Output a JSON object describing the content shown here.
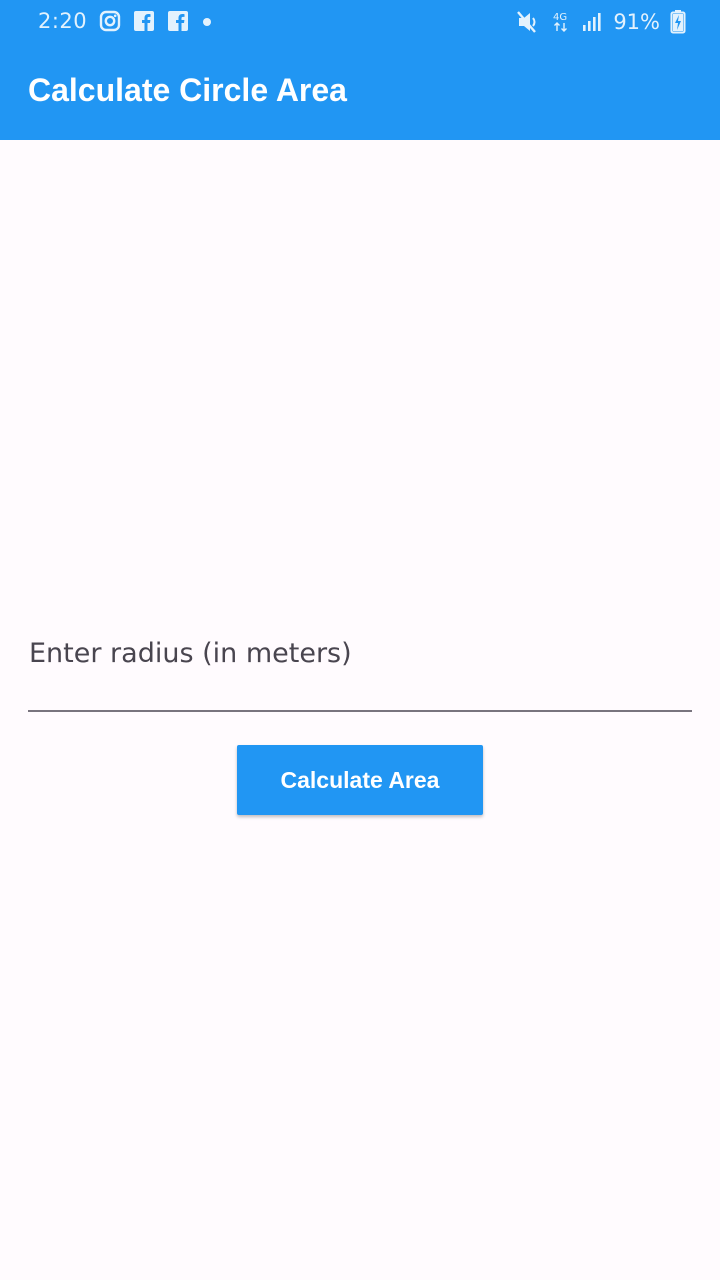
{
  "status_bar": {
    "time": "2:20",
    "battery": "91%",
    "network": "4G",
    "icons": [
      "instagram-icon",
      "facebook-icon",
      "facebook-icon",
      "dot-icon",
      "mute-icon",
      "network-4g-icon",
      "signal-icon",
      "battery-charging-icon"
    ]
  },
  "app_bar": {
    "title": "Calculate Circle Area"
  },
  "form": {
    "radius_label": "Enter radius (in meters)",
    "radius_value": "",
    "calculate_label": "Calculate Area"
  },
  "colors": {
    "primary": "#2196F3",
    "background": "#FFFBFE",
    "on_primary": "#FFFFFF"
  }
}
